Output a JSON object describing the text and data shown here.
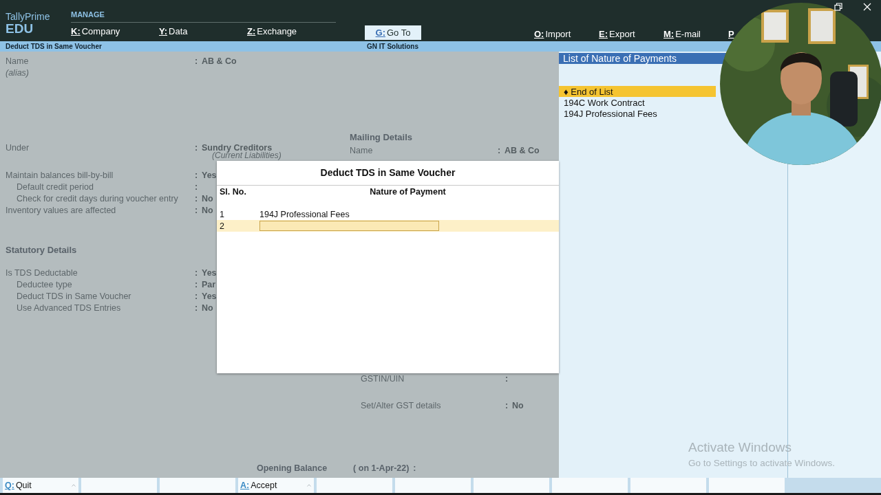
{
  "header": {
    "product": "TallyPrime",
    "edition": "EDU",
    "menu_title": "MANAGE",
    "menu": [
      {
        "key": "K:",
        "label": "Company"
      },
      {
        "key": "Y:",
        "label": "Data"
      },
      {
        "key": "Z:",
        "label": "Exchange"
      }
    ],
    "goto": {
      "key": "G:",
      "label": "Go To"
    },
    "actions": [
      {
        "key": "O:",
        "label": "Import"
      },
      {
        "key": "E:",
        "label": "Export"
      },
      {
        "key": "M:",
        "label": "E-mail"
      },
      {
        "key": "P"
      }
    ]
  },
  "subheader": {
    "title": "Deduct TDS in Same Voucher",
    "company": "GN IT Solutions"
  },
  "form": {
    "left_blocks": [
      {
        "rows": [
          {
            "label": "Name",
            "colon": ":",
            "value": "AB & Co"
          },
          {
            "label": "(alias)",
            "kind": "alias"
          }
        ]
      },
      {
        "rows": [
          {
            "label": "Under",
            "colon": ":",
            "value": "Sundry Creditors",
            "note": "(Current Liabilities)"
          }
        ]
      },
      {
        "rows": [
          {
            "label": "Maintain balances bill-by-bill",
            "colon": ":",
            "value": "Yes",
            "children": [
              {
                "label": "Default credit period",
                "colon": ":"
              },
              {
                "label": "Check for credit days during voucher entry",
                "colon": ":",
                "value": "No"
              }
            ]
          },
          {
            "label": "Inventory values are affected",
            "colon": ":",
            "value": "No"
          }
        ]
      },
      {
        "heading": "Statutory Details",
        "rows": [
          {
            "label": "Is TDS Deductable",
            "colon": ":",
            "value": "Yes",
            "children": [
              {
                "label": "Deductee type",
                "colon": ":",
                "value": "Par"
              },
              {
                "label": "Deduct TDS in Same Voucher",
                "colon": ":",
                "value": "Yes"
              },
              {
                "label": "Use Advanced TDS Entries",
                "colon": ":",
                "value": "No"
              }
            ]
          }
        ]
      }
    ],
    "mailing": {
      "heading": "Mailing Details",
      "rows": [
        {
          "label": "Name",
          "colon": ":",
          "value": "AB & Co"
        }
      ]
    },
    "gst_rows": [
      {
        "label": "GSTIN/UIN",
        "colon": ":"
      },
      {
        "label": "Set/Alter GST details",
        "colon": ":",
        "value": "No"
      }
    ],
    "opening_balance": {
      "label": "Opening Balance",
      "date": "( on 1-Apr-22)",
      "colon": ":"
    }
  },
  "dialog": {
    "title": "Deduct TDS in Same Voucher",
    "columns": [
      "Sl. No.",
      "Nature of Payment"
    ],
    "rows": [
      {
        "sl": "1",
        "nature": "194J Professional Fees",
        "selected": false
      },
      {
        "sl": "2",
        "selected": true
      }
    ]
  },
  "list_panel": {
    "title": "List of Nature of Payments",
    "items": [
      {
        "label": "♦ End of List",
        "selected": true
      },
      {
        "label": "194C Work Contract",
        "selected": false
      },
      {
        "label": "194J Professional Fees",
        "selected": false
      }
    ]
  },
  "bottom_bar": [
    {
      "kind": "key",
      "key": "Q:",
      "label": "Quit"
    },
    {
      "kind": "blank"
    },
    {
      "kind": "blank"
    },
    {
      "kind": "key",
      "key": "A:",
      "label": "Accept"
    },
    {
      "kind": "blank"
    },
    {
      "kind": "blank"
    },
    {
      "kind": "blank"
    },
    {
      "kind": "blank"
    },
    {
      "kind": "blank"
    },
    {
      "kind": "blank"
    }
  ],
  "os_notice": {
    "title": "Activate Windows",
    "text": "Go to Settings to activate Windows."
  }
}
